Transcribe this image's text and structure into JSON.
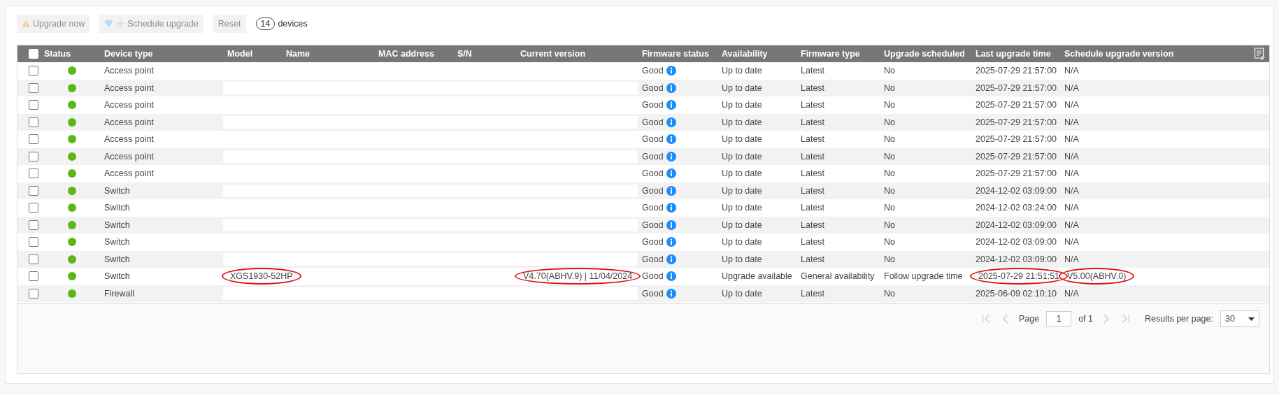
{
  "toolbar": {
    "buttons": [
      {
        "kind": "warning",
        "label": "Upgrade now",
        "disabled": true
      },
      {
        "kind": "schedule",
        "label": "Schedule upgrade",
        "disabled": true
      },
      {
        "kind": "plain",
        "label": "Reset",
        "disabled": true
      }
    ],
    "count": "14",
    "count_label": "devices"
  },
  "table": {
    "header_checkbox": {
      "checked": false
    },
    "columns": [
      {
        "label": "Status"
      },
      {
        "label": "Device type"
      },
      {
        "label": "Model"
      },
      {
        "label": "Name"
      },
      {
        "label": "MAC address"
      },
      {
        "label": "S/N"
      },
      {
        "label": "Current version"
      },
      {
        "label": "Firmware status"
      },
      {
        "label": "Availability"
      },
      {
        "label": "Firmware type"
      },
      {
        "label": "Upgrade scheduled"
      },
      {
        "label": "Last upgrade time"
      },
      {
        "label": "Schedule upgrade version"
      }
    ],
    "rows": [
      {
        "checked": false,
        "color": "#5cb615",
        "device_type": "Access point",
        "firmware_status": "Good",
        "availability": "Up to date",
        "firmware_type": "Latest",
        "upgrade_scheduled": "No",
        "last_upgrade_time": "2025-07-29 21:57:00",
        "schedule_upgrade_version": "N/A"
      },
      {
        "checked": false,
        "color": "#5cb615",
        "device_type": "Access point",
        "firmware_status": "Good",
        "availability": "Up to date",
        "firmware_type": "Latest",
        "upgrade_scheduled": "No",
        "last_upgrade_time": "2025-07-29 21:57:00",
        "schedule_upgrade_version": "N/A"
      },
      {
        "checked": false,
        "color": "#5cb615",
        "device_type": "Access point",
        "firmware_status": "Good",
        "availability": "Up to date",
        "firmware_type": "Latest",
        "upgrade_scheduled": "No",
        "last_upgrade_time": "2025-07-29 21:57:00",
        "schedule_upgrade_version": "N/A"
      },
      {
        "checked": false,
        "color": "#5cb615",
        "device_type": "Access point",
        "firmware_status": "Good",
        "availability": "Up to date",
        "firmware_type": "Latest",
        "upgrade_scheduled": "No",
        "last_upgrade_time": "2025-07-29 21:57:00",
        "schedule_upgrade_version": "N/A"
      },
      {
        "checked": false,
        "color": "#5cb615",
        "device_type": "Access point",
        "firmware_status": "Good",
        "availability": "Up to date",
        "firmware_type": "Latest",
        "upgrade_scheduled": "No",
        "last_upgrade_time": "2025-07-29 21:57:00",
        "schedule_upgrade_version": "N/A"
      },
      {
        "checked": false,
        "color": "#5cb615",
        "device_type": "Access point",
        "firmware_status": "Good",
        "availability": "Up to date",
        "firmware_type": "Latest",
        "upgrade_scheduled": "No",
        "last_upgrade_time": "2025-07-29 21:57:00",
        "schedule_upgrade_version": "N/A"
      },
      {
        "checked": false,
        "color": "#5cb615",
        "device_type": "Access point",
        "firmware_status": "Good",
        "availability": "Up to date",
        "firmware_type": "Latest",
        "upgrade_scheduled": "No",
        "last_upgrade_time": "2025-07-29 21:57:00",
        "schedule_upgrade_version": "N/A"
      },
      {
        "checked": false,
        "color": "#5cb615",
        "device_type": "Switch",
        "firmware_status": "Good",
        "availability": "Up to date",
        "firmware_type": "Latest",
        "upgrade_scheduled": "No",
        "last_upgrade_time": "2024-12-02 03:09:00",
        "schedule_upgrade_version": "N/A"
      },
      {
        "checked": false,
        "color": "#5cb615",
        "device_type": "Switch",
        "firmware_status": "Good",
        "availability": "Up to date",
        "firmware_type": "Latest",
        "upgrade_scheduled": "No",
        "last_upgrade_time": "2024-12-02 03:24:00",
        "schedule_upgrade_version": "N/A"
      },
      {
        "checked": false,
        "color": "#5cb615",
        "device_type": "Switch",
        "firmware_status": "Good",
        "availability": "Up to date",
        "firmware_type": "Latest",
        "upgrade_scheduled": "No",
        "last_upgrade_time": "2024-12-02 03:09:00",
        "schedule_upgrade_version": "N/A"
      },
      {
        "checked": false,
        "color": "#5cb615",
        "device_type": "Switch",
        "firmware_status": "Good",
        "availability": "Up to date",
        "firmware_type": "Latest",
        "upgrade_scheduled": "No",
        "last_upgrade_time": "2024-12-02 03:09:00",
        "schedule_upgrade_version": "N/A"
      },
      {
        "checked": false,
        "color": "#5cb615",
        "device_type": "Switch",
        "firmware_status": "Good",
        "availability": "Up to date",
        "firmware_type": "Latest",
        "upgrade_scheduled": "No",
        "last_upgrade_time": "2024-12-02 03:09:00",
        "schedule_upgrade_version": "N/A"
      },
      {
        "checked": false,
        "color": "#5cb615",
        "device_type": "Switch",
        "model": {
          "text": "XGS1930-52HP",
          "circled": true
        },
        "current_version": {
          "text": "V4.70(ABHV.9) | 11/04/2024",
          "circled": true
        },
        "firmware_status": "Good",
        "availability": "Upgrade available",
        "firmware_type": "General availability",
        "upgrade_scheduled": "Follow upgrade time",
        "last_upgrade_time": {
          "text": "2025-07-29 21:51:51",
          "circled": true
        },
        "schedule_upgrade_version": {
          "text": "V5.00(ABHV.0)",
          "circled": true
        }
      },
      {
        "checked": false,
        "color": "#5cb615",
        "device_type": "Firewall",
        "firmware_status": "Good",
        "availability": "Up to date",
        "firmware_type": "Latest",
        "upgrade_scheduled": "No",
        "last_upgrade_time": "2025-06-09 02:10:10",
        "schedule_upgrade_version": "N/A"
      }
    ]
  },
  "pagination": {
    "page_label": "Page",
    "page": "1",
    "of": "of 1",
    "per_page_label": "Results per page:",
    "per_page": "30"
  }
}
